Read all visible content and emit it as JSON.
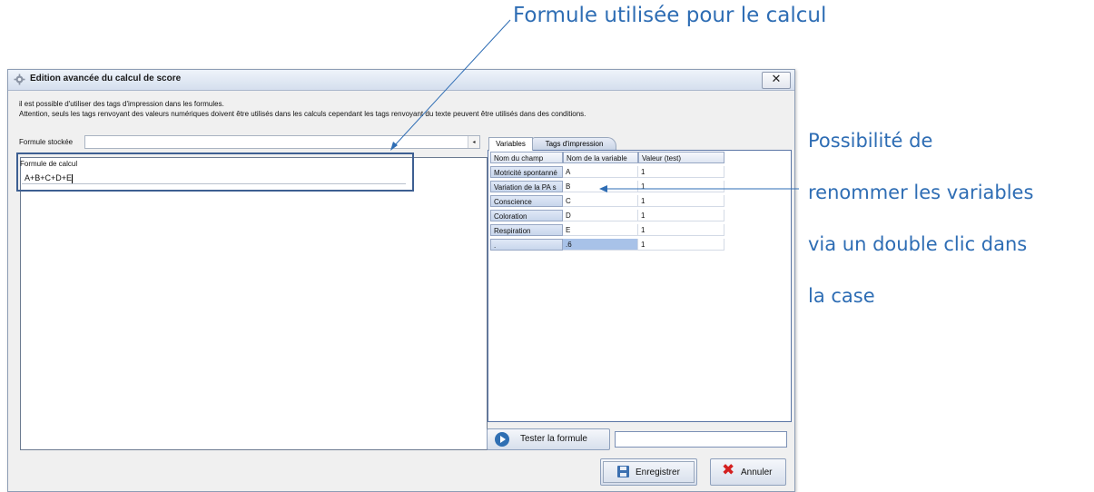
{
  "annotations": {
    "top": "Formule utilisée pour le calcul",
    "right_lines": [
      "Possibilité de",
      "renommer les variables",
      "via un double clic dans",
      "la case"
    ],
    "color": "#2e6db4"
  },
  "window": {
    "title": "Edition avancée du calcul de score",
    "close_label": "✕",
    "info_line1": "il est possible d'utiliser des tags d'impression dans les formules.",
    "info_line2": "Attention, seuls les tags renvoyant des valeurs numériques doivent être utilisés dans les calculs cependant les tags renvoyant du texte peuvent être utilisés dans des conditions."
  },
  "left": {
    "stored_formula_label": "Formule stockée",
    "stored_formula_value": "",
    "formula_label": "Formule de calcul",
    "formula_value": "A+B+C+D+E"
  },
  "tabs": [
    {
      "label": "Variables",
      "active": true
    },
    {
      "label": "Tags d'impression",
      "active": false
    }
  ],
  "table": {
    "headers": [
      "Nom du champ",
      "Nom de la variable",
      "Valeur (test)"
    ],
    "rows": [
      {
        "field": "Motricité spontanné",
        "variable": "A",
        "value": "1"
      },
      {
        "field": "Variation de la PA s",
        "variable": "B",
        "value": "1"
      },
      {
        "field": "Conscience",
        "variable": "C",
        "value": "1"
      },
      {
        "field": "Coloration",
        "variable": "D",
        "value": "1"
      },
      {
        "field": "Respiration",
        "variable": "E",
        "value": "1"
      },
      {
        "field": ".",
        "variable": ".6",
        "value": "1"
      }
    ]
  },
  "buttons": {
    "test_label": "Tester la formule",
    "test_result": "",
    "save_label": "Enregistrer",
    "cancel_label": "Annuler"
  },
  "icons": {
    "title": "gear-icon",
    "test": "play-circle-icon",
    "save": "floppy-disk-icon",
    "cancel": "red-x-icon"
  }
}
